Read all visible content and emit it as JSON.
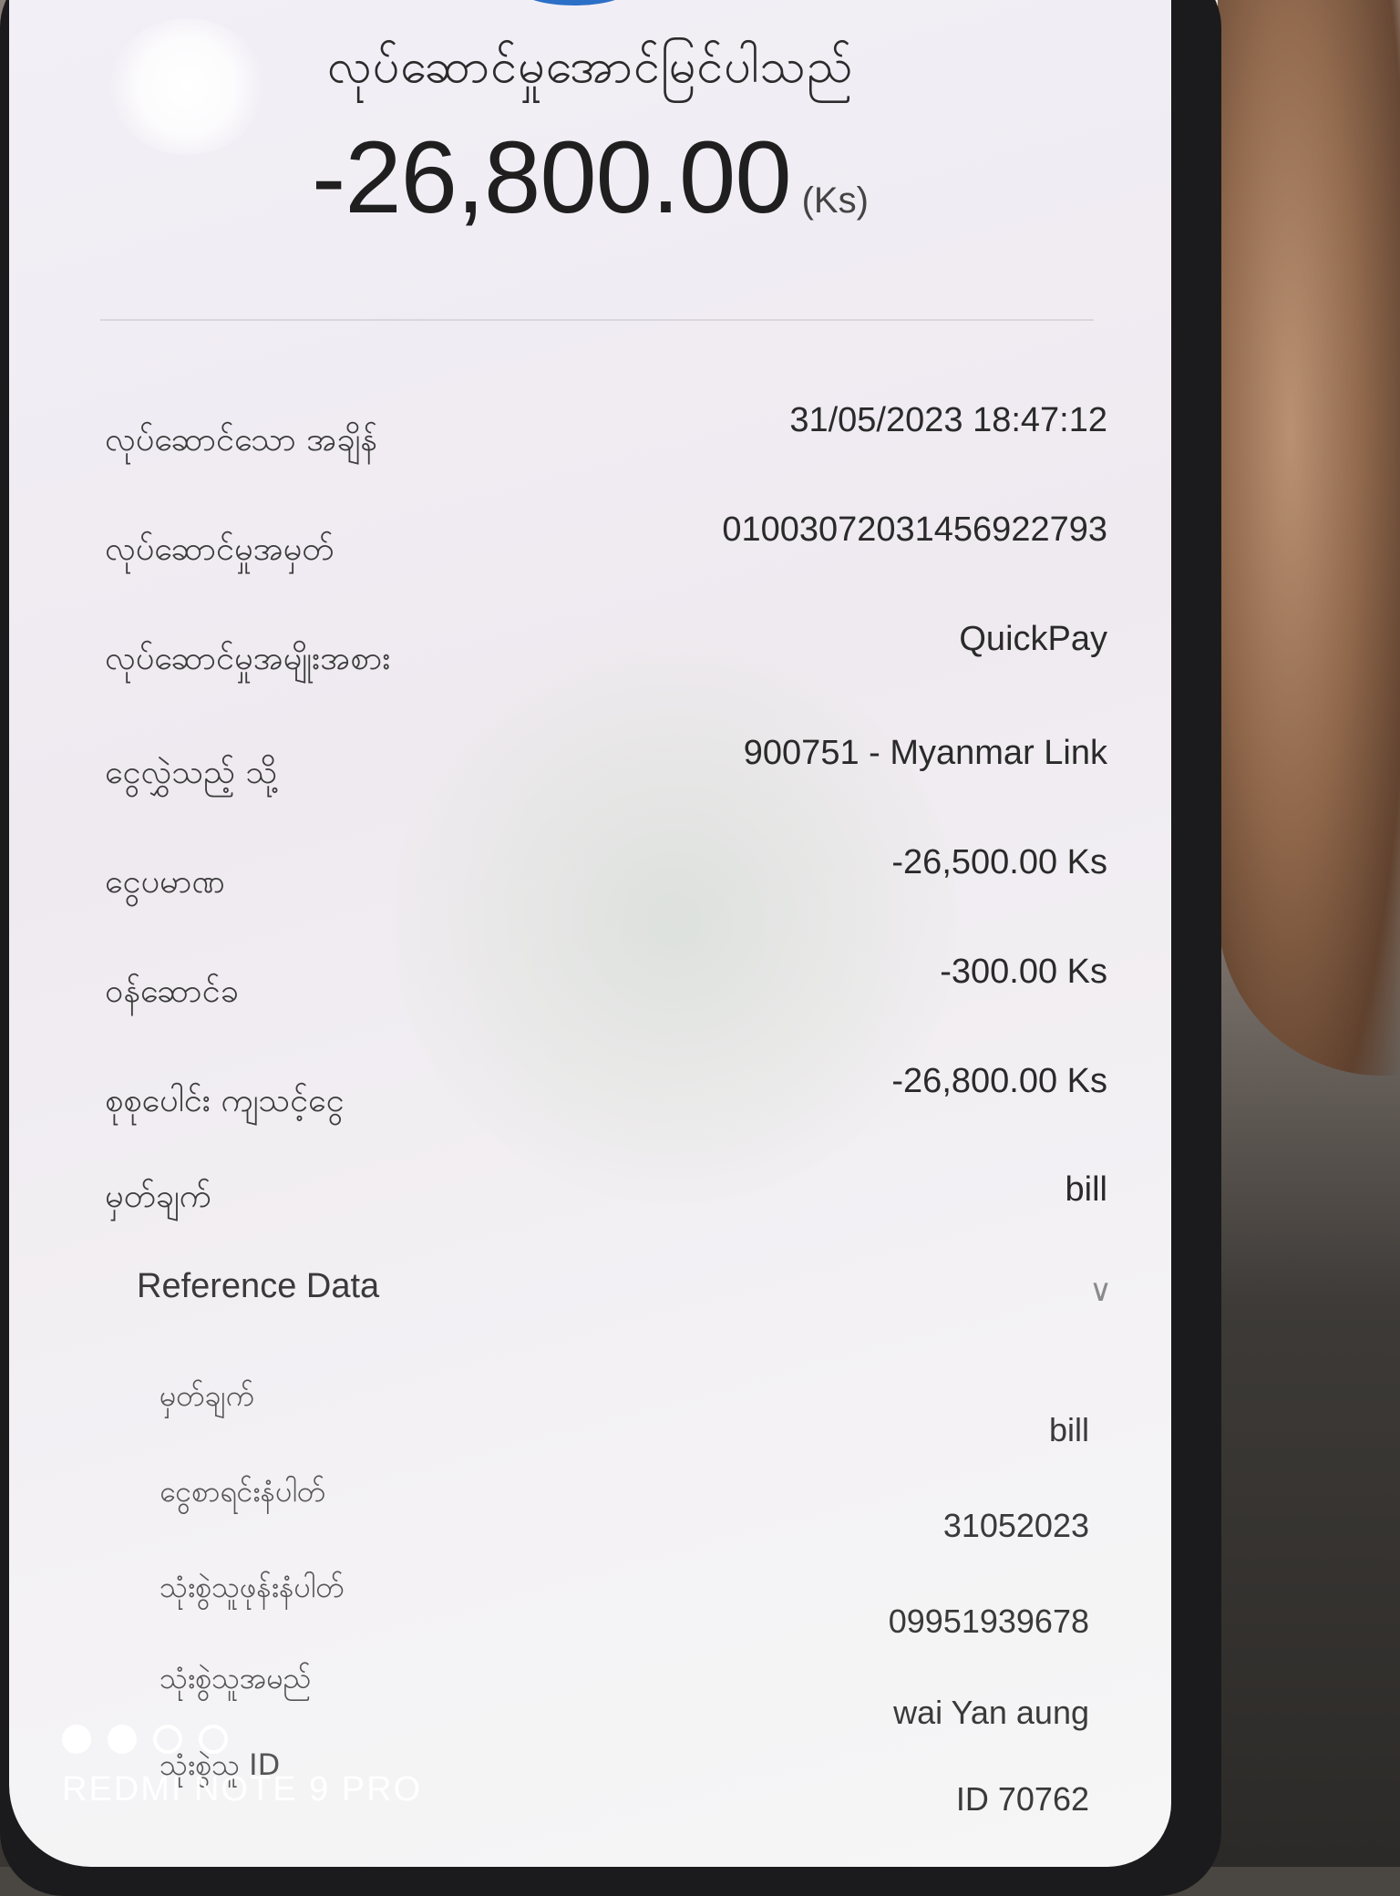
{
  "header": {
    "status_title": "လုပ်ဆောင်မှုအောင်မြင်ပါသည်",
    "amount": "-26,800.00",
    "currency": "(Ks)"
  },
  "details": [
    {
      "label": "လုပ်ဆောင်သော အချိန်",
      "value": "31/05/2023 18:47:12"
    },
    {
      "label": "လုပ်ဆောင်မှုအမှတ်",
      "value": "01003072031456922793"
    },
    {
      "label": "လုပ်ဆောင်မှုအမျိုးအစား",
      "value": "QuickPay"
    },
    {
      "label": "ငွေလွှဲသည့် သို့",
      "value": "900751 - Myanmar Link"
    },
    {
      "label": "ငွေပမာဏ",
      "value": "-26,500.00 Ks"
    },
    {
      "label": "ဝန်ဆောင်ခ",
      "value": "-300.00 Ks"
    },
    {
      "label": "စုစုပေါင်း ကျသင့်ငွေ",
      "value": "-26,800.00 Ks"
    },
    {
      "label": "မှတ်ချက်",
      "value": "bill"
    }
  ],
  "reference": {
    "title": "Reference Data",
    "chevron_icon": "chevron-down-icon",
    "rows": [
      {
        "label": "မှတ်ချက်",
        "value": "bill"
      },
      {
        "label": "ငွေစာရင်းနံပါတ်",
        "value": "31052023"
      },
      {
        "label": "သုံးစွဲသူဖုန်းနံပါတ်",
        "value": "09951939678"
      },
      {
        "label": "သုံးစွဲသူအမည်",
        "value": "wai Yan aung"
      },
      {
        "label": "သုံးစွဲသူ ID",
        "value": "ID 70762"
      }
    ]
  },
  "watermark": {
    "text": "REDMI NOTE 9 PRO"
  },
  "colors": {
    "screen_bg": "#f2eff6",
    "text_primary": "#2a2a2a",
    "accent_blue": "#2c6fc7"
  }
}
